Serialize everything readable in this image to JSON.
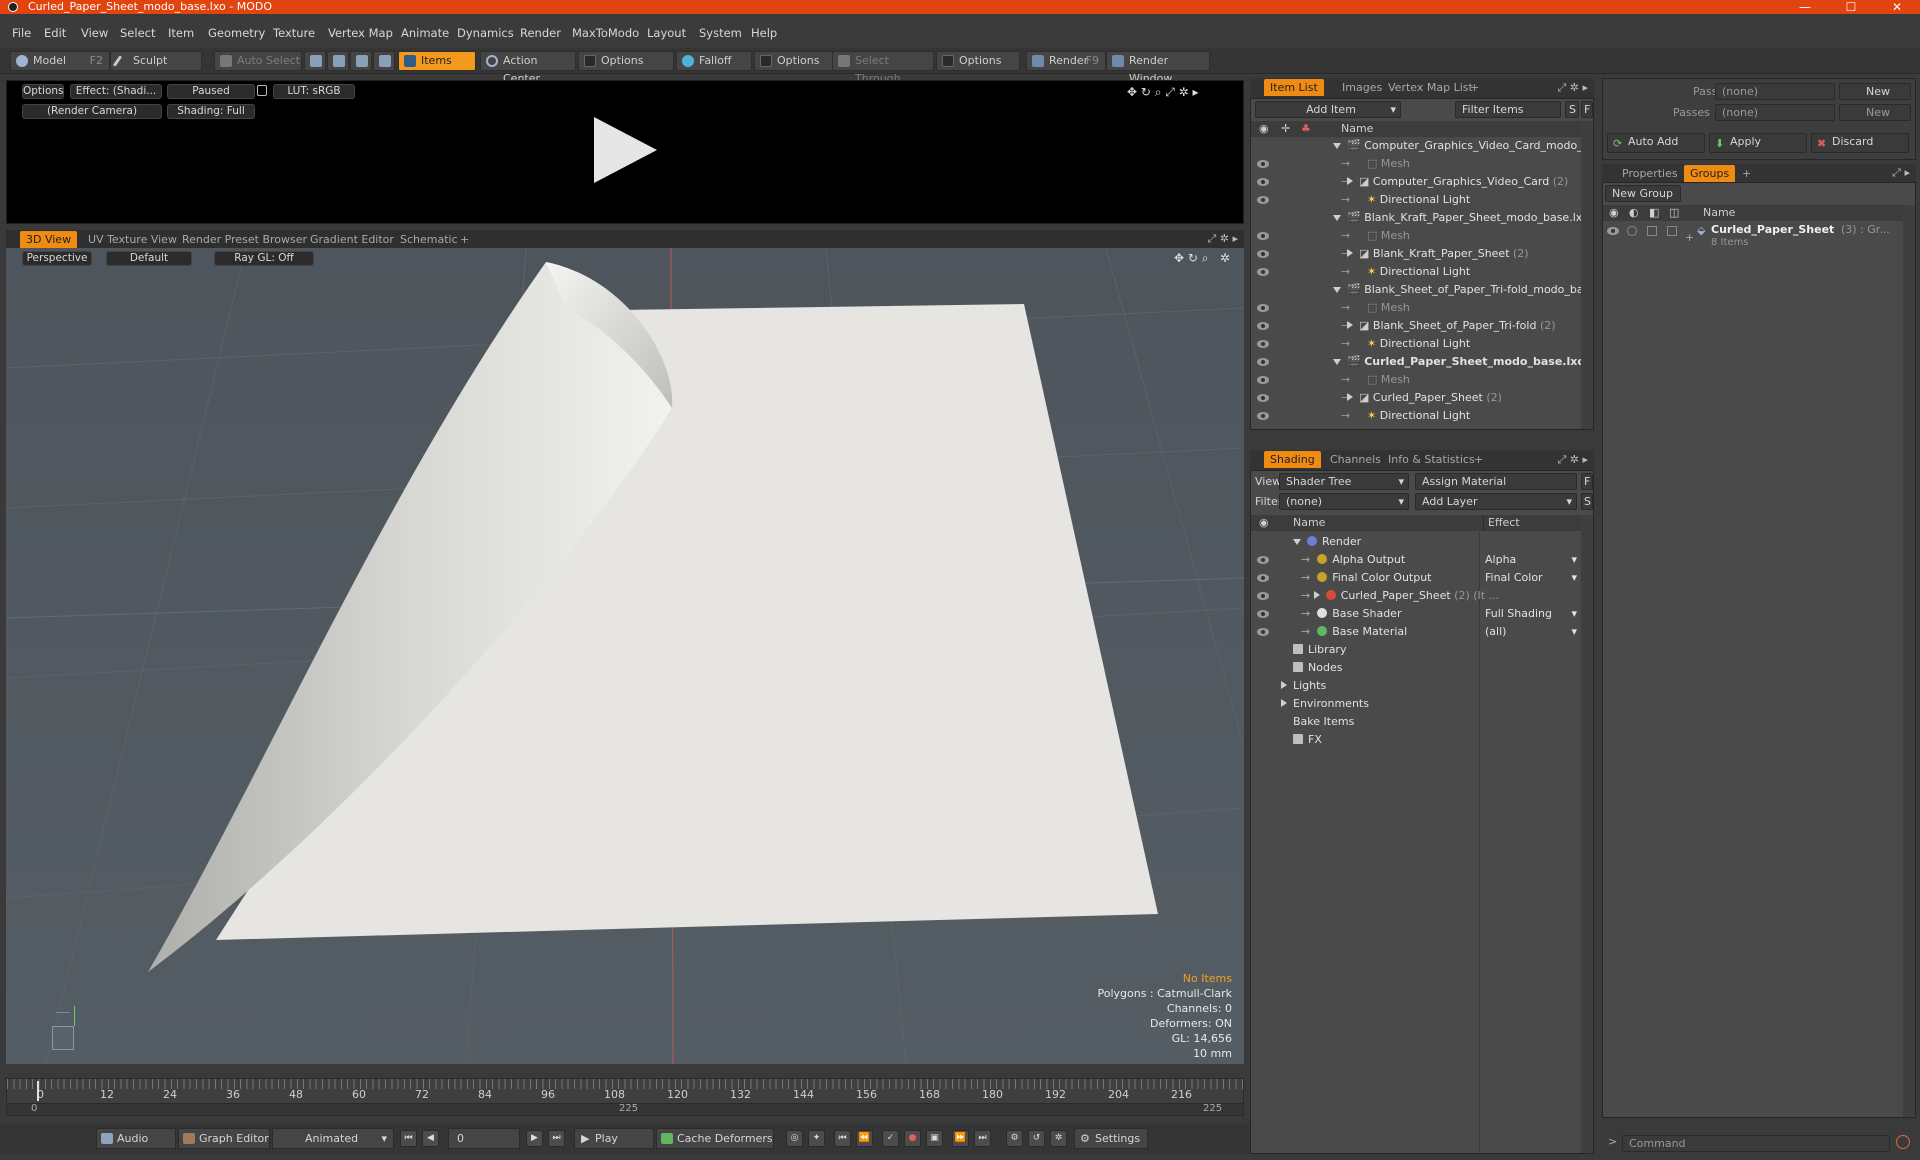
{
  "window": {
    "title": "Curled_Paper_Sheet_modo_base.lxo - MODO",
    "minimize": "—",
    "maximize": "☐",
    "close": "✕"
  },
  "menu": [
    "File",
    "Edit",
    "View",
    "Select",
    "Item",
    "Geometry",
    "Texture",
    "Vertex Map",
    "Animate",
    "Dynamics",
    "Render",
    "MaxToModo",
    "Layout",
    "System",
    "Help"
  ],
  "toolbar": {
    "model": "Model",
    "model_key": "F2",
    "sculpt": "Sculpt",
    "auto_select": "Auto Select",
    "items": "Items",
    "action_center": "Action Center",
    "options1": "Options",
    "falloff": "Falloff",
    "options2": "Options",
    "select_through": "Select Through",
    "options3": "Options",
    "render": "Render",
    "render_key": "F9",
    "render_window": "Render Window"
  },
  "preview": {
    "options": "Options",
    "effect": "Effect: (Shadi...",
    "paused": "Paused",
    "lut": "LUT: sRGB",
    "camera": "(Render Camera)",
    "shading": "Shading: Full"
  },
  "view_tabs": [
    "3D View",
    "UV Texture View",
    "Render Preset Browser",
    "Gradient Editor",
    "Schematic",
    "+"
  ],
  "viewport": {
    "perspective": "Perspective",
    "default": "Default",
    "raygl": "Ray GL: Off",
    "info": {
      "no_items": "No Items",
      "polygons": "Polygons : Catmull-Clark",
      "channels": "Channels: 0",
      "deformers": "Deformers: ON",
      "gl": "GL: 14,656",
      "scale": "10 mm"
    }
  },
  "timeline": {
    "ticks": [
      "0",
      "12",
      "24",
      "36",
      "48",
      "60",
      "72",
      "84",
      "96",
      "108",
      "120",
      "132",
      "144",
      "156",
      "168",
      "180",
      "192",
      "204",
      "216"
    ],
    "start": "0",
    "mid": "225",
    "end": "225"
  },
  "bottombar": {
    "audio": "Audio",
    "graph_editor": "Graph Editor",
    "animated": "Animated",
    "frame": "0",
    "play": "Play",
    "cache_deformers": "Cache Deformers",
    "settings": "Settings"
  },
  "item_list": {
    "tabs": [
      "Item List",
      "Images",
      "Vertex Map List",
      "+"
    ],
    "add_item": "Add Item",
    "filter_items": "Filter Items",
    "s": "S",
    "f": "F",
    "col_name": "Name",
    "rows": [
      {
        "label": "Computer_Graphics_Video_Card_modo_b ...",
        "indent": 1,
        "type": "scene",
        "eye": false
      },
      {
        "label": "Mesh",
        "indent": 3,
        "type": "mesh",
        "eye": true
      },
      {
        "label": "Computer_Graphics_Video_Card",
        "count": "(2)",
        "indent": 2,
        "type": "group",
        "eye": true
      },
      {
        "label": "Directional Light",
        "indent": 3,
        "type": "light",
        "eye": true
      },
      {
        "label": "Blank_Kraft_Paper_Sheet_modo_base.lxo",
        "indent": 1,
        "type": "scene",
        "eye": false
      },
      {
        "label": "Mesh",
        "indent": 3,
        "type": "mesh",
        "eye": true
      },
      {
        "label": "Blank_Kraft_Paper_Sheet",
        "count": "(2)",
        "indent": 2,
        "type": "group",
        "eye": true
      },
      {
        "label": "Directional Light",
        "indent": 3,
        "type": "light",
        "eye": true
      },
      {
        "label": "Blank_Sheet_of_Paper_Tri-fold_modo_ba ...",
        "indent": 1,
        "type": "scene",
        "eye": false
      },
      {
        "label": "Mesh",
        "indent": 3,
        "type": "mesh",
        "eye": true
      },
      {
        "label": "Blank_Sheet_of_Paper_Tri-fold",
        "count": "(2)",
        "indent": 2,
        "type": "group",
        "eye": true
      },
      {
        "label": "Directional Light",
        "indent": 3,
        "type": "light",
        "eye": true
      },
      {
        "label": "Curled_Paper_Sheet_modo_base.lxo",
        "indent": 1,
        "type": "scene",
        "eye": true,
        "bold": true
      },
      {
        "label": "Mesh",
        "indent": 3,
        "type": "mesh",
        "eye": true
      },
      {
        "label": "Curled_Paper_Sheet",
        "count": "(2)",
        "indent": 2,
        "type": "group",
        "eye": true
      },
      {
        "label": "Directional Light",
        "indent": 3,
        "type": "light",
        "eye": true
      }
    ]
  },
  "shading": {
    "tabs": [
      "Shading",
      "Channels",
      "Info & Statistics",
      "+"
    ],
    "view_label": "View",
    "view_value": "Shader Tree",
    "assign_material": "Assign Material",
    "filter_label": "Filter",
    "filter_value": "(none)",
    "add_layer": "Add Layer",
    "f": "F",
    "s": "S",
    "col_name": "Name",
    "col_effect": "Effect",
    "rows": [
      {
        "label": "Render",
        "effect": "",
        "indent": 0,
        "icon": "#6f7fd6",
        "eye": false
      },
      {
        "label": "Alpha Output",
        "effect": "Alpha",
        "indent": 1,
        "icon": "#c9a227",
        "eye": true
      },
      {
        "label": "Final Color Output",
        "effect": "Final Color",
        "indent": 1,
        "icon": "#c9a227",
        "eye": true
      },
      {
        "label": "Curled_Paper_Sheet",
        "count": "(2) (It ...",
        "effect": "",
        "indent": 1,
        "icon": "#d94a3a",
        "eye": true
      },
      {
        "label": "Base Shader",
        "effect": "Full Shading",
        "indent": 1,
        "icon": "#e0e0e0",
        "eye": true
      },
      {
        "label": "Base Material",
        "effect": "(all)",
        "indent": 1,
        "icon": "#5fb85f",
        "eye": true
      },
      {
        "label": "Library",
        "effect": "",
        "indent": 0,
        "icon": "folder",
        "eye": false
      },
      {
        "label": "Nodes",
        "effect": "",
        "indent": 0,
        "icon": "folder",
        "eye": false
      },
      {
        "label": "Lights",
        "effect": "",
        "indent": -1,
        "icon": "",
        "eye": false
      },
      {
        "label": "Environments",
        "effect": "",
        "indent": -1,
        "icon": "",
        "eye": false
      },
      {
        "label": "Bake Items",
        "effect": "",
        "indent": -1,
        "icon": "",
        "eye": false
      },
      {
        "label": "FX",
        "effect": "",
        "indent": 0,
        "icon": "folder",
        "eye": false
      }
    ]
  },
  "groups": {
    "pass_groups_label": "Pass Groups",
    "pass_groups_value": "(none)",
    "new1": "New",
    "passes_label": "Passes",
    "passes_value": "(none)",
    "new2": "New",
    "auto_add": "Auto Add",
    "apply": "Apply",
    "discard": "Discard",
    "tabs": [
      "Properties",
      "Groups",
      "+"
    ],
    "new_group": "New Group",
    "col_name": "Name",
    "item_label": "Curled_Paper_Sheet",
    "item_suffix": "(3) : Gr...",
    "item_count": "8 Items",
    "command": "Command"
  }
}
